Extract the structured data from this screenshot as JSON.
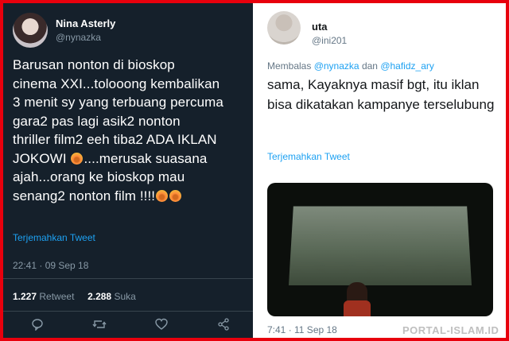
{
  "left_tweet": {
    "name": "Nina Asterly",
    "handle": "@nynazka",
    "text_lines": [
      "Barusan nonton di bioskop",
      "cinema XXI...tolooong kembalikan",
      "3 menit sy yang terbuang percuma",
      "gara2 pas lagi asik2 nonton",
      "thriller film2 eeh tiba2 ADA IKLAN",
      "JOKOWI",
      "....merusak suasana",
      "ajah...orang ke bioskop mau",
      "senang2 nonton film !!!!"
    ],
    "translate": "Terjemahkan Tweet",
    "timestamp": "22:41 · 09 Sep 18",
    "retweets_count": "1.227",
    "retweets_label": "Retweet",
    "likes_count": "2.288",
    "likes_label": "Suka",
    "icons": [
      "reply-icon",
      "retweet-icon",
      "like-icon",
      "share-icon"
    ]
  },
  "right_tweet": {
    "name": "uta",
    "handle": "@ini201",
    "reply_prefix": "Membalas",
    "reply_to_1": "@nynazka",
    "reply_conj": "dan",
    "reply_to_2": "@hafidz_ary",
    "text": "sama,  Kayaknya masif bgt,  itu iklan bisa dikatakan kampanye terselubung",
    "translate": "Terjemahkan Tweet",
    "timestamp": "7:41 · 11 Sep 18"
  },
  "watermark": "PORTAL-ISLAM.ID",
  "colors": {
    "frame_border": "#e8000d",
    "dark_bg": "#15202b",
    "link_blue": "#1da1f2"
  }
}
